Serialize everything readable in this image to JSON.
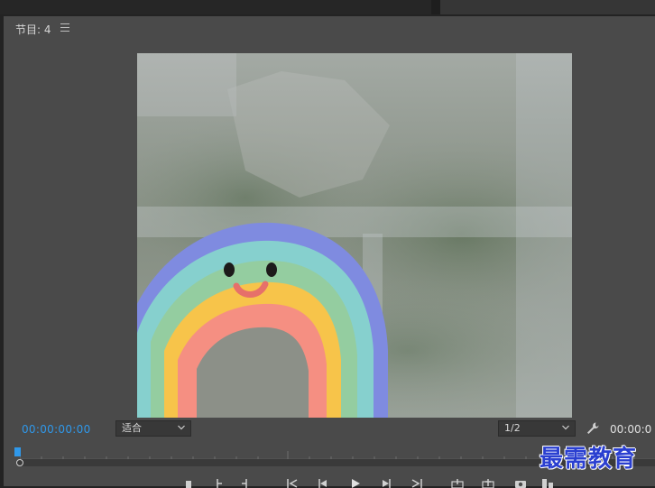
{
  "panel": {
    "title": "节目: 4"
  },
  "playback": {
    "current_timecode": "00:00:00:00",
    "duration_timecode": "00:00:0",
    "fit_label": "适合",
    "resolution_label": "1/2",
    "playhead_position": 0.0
  },
  "watermark": {
    "text": "最需教育"
  },
  "colors": {
    "timecode_accent": "#2f98ea",
    "panel_bg": "#4a4a4a",
    "watermark": "#2a3fd0"
  },
  "icons": [
    "menu-icon",
    "chevron-down-icon",
    "wrench-icon",
    "mark-in-icon",
    "mark-out-icon",
    "go-to-in-icon",
    "step-back-icon",
    "play-icon",
    "step-forward-icon",
    "go-to-out-icon",
    "lift-icon",
    "extract-icon",
    "export-frame-icon",
    "button-editor-icon"
  ]
}
